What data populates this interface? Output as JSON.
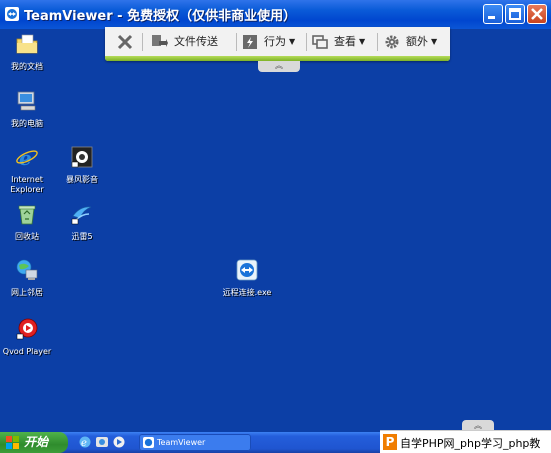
{
  "window": {
    "title": "TeamViewer - 免费授权（仅供非商业使用）"
  },
  "toolbar": {
    "file_transfer": "文件传送",
    "actions": "行为",
    "view": "查看",
    "extras": "额外"
  },
  "desktop": {
    "icons": [
      {
        "label": "我的文档",
        "icon": "my-documents-icon"
      },
      {
        "label": "我的电脑",
        "icon": "my-computer-icon"
      },
      {
        "label": "Internet Explorer",
        "icon": "internet-explorer-icon"
      },
      {
        "label": "暴风影音",
        "icon": "storm-player-icon"
      },
      {
        "label": "回收站",
        "icon": "recycle-bin-icon"
      },
      {
        "label": "迅雷5",
        "icon": "xunlei-icon"
      },
      {
        "label": "网上邻居",
        "icon": "network-places-icon"
      },
      {
        "label": "远程连接.exe",
        "icon": "teamviewer-exe-icon"
      },
      {
        "label": "Qvod Player",
        "icon": "qvod-player-icon"
      }
    ]
  },
  "taskbar": {
    "start_label": "开始",
    "active_window": "TeamViewer"
  },
  "watermark": {
    "logo_letter": "P",
    "text": "自学PHP网_php学习_php教"
  },
  "colors": {
    "desktop_bg": "#0c3fa6",
    "toolbar_accent": "#8cc63f",
    "titlebar": "#0a5bd8"
  }
}
